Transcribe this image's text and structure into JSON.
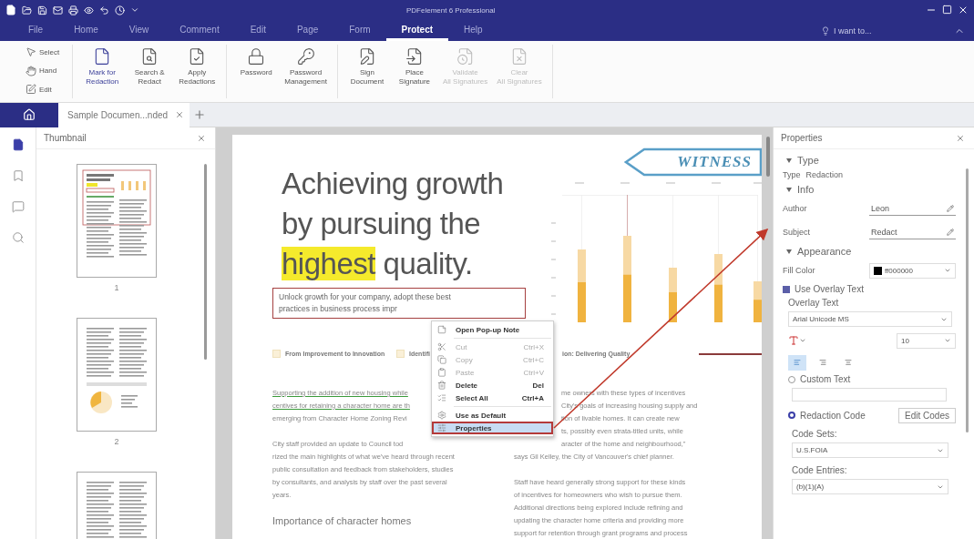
{
  "window": {
    "title": "PDFelement 6 Professional"
  },
  "menu": [
    {
      "label": "File",
      "selected": false
    },
    {
      "label": "Home",
      "selected": false
    },
    {
      "label": "View",
      "selected": false
    },
    {
      "label": "Comment",
      "selected": false
    },
    {
      "label": "Edit",
      "selected": false
    },
    {
      "label": "Page",
      "selected": false
    },
    {
      "label": "Form",
      "selected": false
    },
    {
      "label": "Protect",
      "selected": true
    },
    {
      "label": "Help",
      "selected": false
    }
  ],
  "search": {
    "placeholder": "I want to..."
  },
  "ribbon": {
    "tools": [
      {
        "kind": "select",
        "label": "Select"
      },
      {
        "kind": "hand",
        "label": "Hand"
      },
      {
        "kind": "edit",
        "label": "Edit"
      }
    ],
    "groups": [
      [
        {
          "kind": "mark",
          "label": "Mark for\nRedaction",
          "disabled": false,
          "selected": true
        },
        {
          "kind": "search",
          "label": "Search &\nRedact",
          "disabled": false,
          "selected": false
        },
        {
          "kind": "apply",
          "label": "Apply\nRedactions",
          "disabled": false,
          "selected": false
        }
      ],
      [
        {
          "kind": "password",
          "label": "Password",
          "disabled": false,
          "selected": false
        },
        {
          "kind": "manage",
          "label": "Password\nManagement",
          "disabled": false,
          "selected": false
        }
      ],
      [
        {
          "kind": "sign",
          "label": "Sign\nDocument",
          "disabled": false,
          "selected": false
        },
        {
          "kind": "place",
          "label": "Place\nSignature",
          "disabled": false,
          "selected": false
        },
        {
          "kind": "validate",
          "label": "Validate\nAll Signatures",
          "disabled": true,
          "selected": false
        },
        {
          "kind": "clear",
          "label": "Clear\nAll Signatures",
          "disabled": true,
          "selected": false
        }
      ]
    ]
  },
  "tabs": [
    {
      "label": "Sample Documen...nded",
      "selected": true
    }
  ],
  "rail": [
    {
      "kind": "pages",
      "selected": true
    },
    {
      "kind": "bookmark",
      "selected": false
    },
    {
      "kind": "comment",
      "selected": false
    },
    {
      "kind": "search",
      "selected": false
    }
  ],
  "thumbnails": {
    "title": "Thumbnail",
    "pages": [
      {
        "kind": "cover",
        "label": "1"
      },
      {
        "kind": "chart",
        "label": "2"
      },
      {
        "kind": "text"
      }
    ]
  },
  "document": {
    "stamp": "WITNESS",
    "headline": {
      "lines": [
        "Achieving growth",
        "by pursuing the"
      ],
      "highlight": "highest",
      "tail": " quality."
    },
    "redaction_lines": [
      "Unlock growth for your company, adopt these best",
      "practices in business process impr"
    ],
    "legend": [
      {
        "text": "From Improvement to Innovation",
        "swatch": true
      },
      {
        "text": "Identifi",
        "swatch": true
      },
      {
        "text": "ion: Delivering Quality",
        "swatch": false
      }
    ],
    "left_column": [
      {
        "kind": "paragraph",
        "lines": [
          {
            "text": "Supporting the addition of new housing while",
            "underlined": true
          },
          {
            "text": "centives for retaining a character home are th",
            "underlined": true
          },
          {
            "text": "emerging from Character Home Zoning Revi",
            "underlined": false
          }
        ]
      },
      {
        "kind": "paragraph",
        "lines": [
          "City staff provided an update to Council tod",
          "rized the main highlights of what we've heard through recent",
          "public consultation and feedback from stakeholders, studies",
          "by consultants, and analysis by staff over the past several",
          "years."
        ]
      },
      {
        "kind": "heading",
        "lines": [
          "Importance of character homes"
        ]
      }
    ],
    "right_column": [
      {
        "kind": "cut_paragraph",
        "lines": [
          "me owners with these types of incentives",
          "City's goals of increasing housing supply and",
          "tion of livable homes.  It can create new",
          "ts, possibly even strata-titled units, while",
          "aracter of the home and neighbourhood,\""
        ]
      },
      {
        "kind": "paragraph",
        "lines": [
          "says Gil Kelley, the City of Vancouver's chief planner."
        ]
      },
      {
        "kind": "paragraph",
        "lines": [
          "Staff have heard generally strong support for these kinds",
          "of incentives for homeowners who wish to pursue them.",
          "Additional directions being explored include refining and",
          "updating the character home criteria and providing more",
          "support for retention through grant programs and process"
        ]
      }
    ]
  },
  "context_menu": [
    [
      {
        "kind": "note",
        "label": "Open Pop-up Note",
        "disabled": false,
        "selected": false
      }
    ],
    [
      {
        "kind": "cut",
        "label": "Cut",
        "shortcut": "Ctrl+X",
        "disabled": true,
        "selected": false
      },
      {
        "kind": "copy",
        "label": "Copy",
        "shortcut": "Ctrl+C",
        "disabled": true,
        "selected": false
      },
      {
        "kind": "paste",
        "label": "Paste",
        "shortcut": "Ctrl+V",
        "disabled": true,
        "selected": false
      },
      {
        "kind": "delete",
        "label": "Delete",
        "shortcut": "Del",
        "disabled": false,
        "selected": false
      },
      {
        "kind": "selectall",
        "label": "Select All",
        "shortcut": "Ctrl+A",
        "disabled": false,
        "selected": false
      }
    ],
    [
      {
        "kind": "default",
        "label": "Use as Default",
        "disabled": false,
        "selected": false
      },
      {
        "kind": "properties",
        "label": "Properties",
        "disabled": false,
        "selected": true
      }
    ]
  ],
  "properties": {
    "title": "Properties",
    "type_heading": "Type",
    "type_label": "Type",
    "type_value": "Redaction",
    "info_heading": "Info",
    "author_label": "Author",
    "author": "Leon",
    "subject_label": "Subject",
    "subject": "Redact",
    "appearance_heading": "Appearance",
    "fill_label": "Fill Color",
    "fill": {
      "color": "#000000",
      "value": "ff000000"
    },
    "use_overlay": {
      "label": "Use Overlay Text",
      "checked": true
    },
    "overlay_label": "Overlay Text",
    "font": "Arial Unicode MS",
    "font_size": "10",
    "alignment": [
      {
        "kind": "left",
        "selected": true
      },
      {
        "kind": "right",
        "selected": false
      },
      {
        "kind": "center",
        "selected": false
      }
    ],
    "custom_text": {
      "label": "Custom Text",
      "selected": false
    },
    "redaction_code": {
      "label": "Redaction Code",
      "selected": true
    },
    "edit_codes": "Edit Codes",
    "code_sets_label": "Code Sets:",
    "code_set": "U.S.FOIA",
    "code_entries_label": "Code Entries:",
    "code_entry": "(b)(1)(A)"
  }
}
